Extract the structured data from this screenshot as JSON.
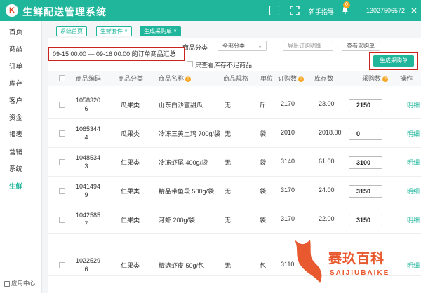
{
  "header": {
    "logo_letter": "K",
    "title": "生鲜配送管理系统",
    "guide": "新手指导",
    "badge": "0",
    "phone": "13027506572",
    "brand_color": "#1fb69b"
  },
  "sidebar": {
    "items": [
      {
        "label": "首页"
      },
      {
        "label": "商品"
      },
      {
        "label": "订单"
      },
      {
        "label": "库存"
      },
      {
        "label": "客户"
      },
      {
        "label": "资金"
      },
      {
        "label": "报表"
      },
      {
        "label": "营销"
      },
      {
        "label": "系统"
      },
      {
        "label": "生鲜"
      }
    ],
    "active": "生鲜",
    "footer": "应用中心"
  },
  "tabs": [
    {
      "label": "系统首页"
    },
    {
      "label": "生鲜套件"
    },
    {
      "label": "生成采购单"
    }
  ],
  "filters": {
    "category_label": "商品分类",
    "category_value": "全部分类",
    "export_button": "导出订购明细",
    "view_button": "查看采购单",
    "only_low_stock": "只查看库存不足商品",
    "date_range": "09-15 00:00 — 09-16 00:00 的订单商品汇总",
    "generate_button": "生成采购单"
  },
  "table": {
    "columns": [
      "商品编码",
      "商品分类",
      "商品名称",
      "商品规格",
      "单位",
      "订购数",
      "库存数",
      "采购数",
      "操作"
    ],
    "rows": [
      {
        "code_a": "1058320",
        "code_b": "6",
        "category": "瓜果类",
        "name": "山东白沙蜜甜瓜",
        "spec": "无",
        "unit": "斤",
        "ordered": "2170",
        "stock": "23.00",
        "purchase": "2150",
        "action": "明细"
      },
      {
        "code_a": "1065344",
        "code_b": "4",
        "category": "瓜果类",
        "name": "冷冻三黄土鸡 700g/袋",
        "spec": "无",
        "unit": "袋",
        "ordered": "2010",
        "stock": "2018.00",
        "purchase": "0",
        "action": "明细"
      },
      {
        "code_a": "1048534",
        "code_b": "3",
        "category": "仁果类",
        "name": "冷冻虾尾 400g/袋",
        "spec": "无",
        "unit": "袋",
        "ordered": "3140",
        "stock": "61.00",
        "purchase": "3100",
        "action": "明细"
      },
      {
        "code_a": "1041494",
        "code_b": "9",
        "category": "仁果类",
        "name": "精品带鱼段 500g/袋",
        "spec": "无",
        "unit": "袋",
        "ordered": "3170",
        "stock": "24.00",
        "purchase": "3150",
        "action": "明细"
      },
      {
        "code_a": "1042585",
        "code_b": "7",
        "category": "仁果类",
        "name": "河虾 200g/袋",
        "spec": "无",
        "unit": "袋",
        "ordered": "3170",
        "stock": "22.00",
        "purchase": "3150",
        "action": "明细"
      },
      {
        "code_a": "1022529",
        "code_b": "6",
        "category": "仁果类",
        "name": "精选虾皮 50g/包",
        "spec": "无",
        "unit": "包",
        "ordered": "3110",
        "stock": "",
        "purchase": "",
        "action": "明细"
      }
    ]
  },
  "watermark": {
    "title": "赛玖百科",
    "subtitle": "SAIJIUBAIKE"
  }
}
